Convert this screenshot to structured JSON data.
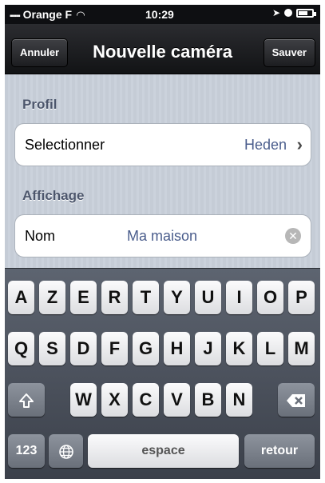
{
  "status_bar": {
    "carrier": "Orange F",
    "time": "10:29"
  },
  "nav": {
    "cancel_label": "Annuler",
    "title": "Nouvelle caméra",
    "save_label": "Sauver"
  },
  "sections": {
    "profil": {
      "header": "Profil",
      "row_label": "Selectionner",
      "row_value": "Heden"
    },
    "affichage": {
      "header": "Affichage",
      "row_label": "Nom",
      "row_value": "Ma maison"
    }
  },
  "keyboard": {
    "row1": [
      "A",
      "Z",
      "E",
      "R",
      "T",
      "Y",
      "U",
      "I",
      "O",
      "P"
    ],
    "row2": [
      "Q",
      "S",
      "D",
      "F",
      "G",
      "H",
      "J",
      "K",
      "L",
      "M"
    ],
    "row3": [
      "W",
      "X",
      "C",
      "V",
      "B",
      "N"
    ],
    "numbers_label": "123",
    "space_label": "espace",
    "return_label": "retour"
  }
}
